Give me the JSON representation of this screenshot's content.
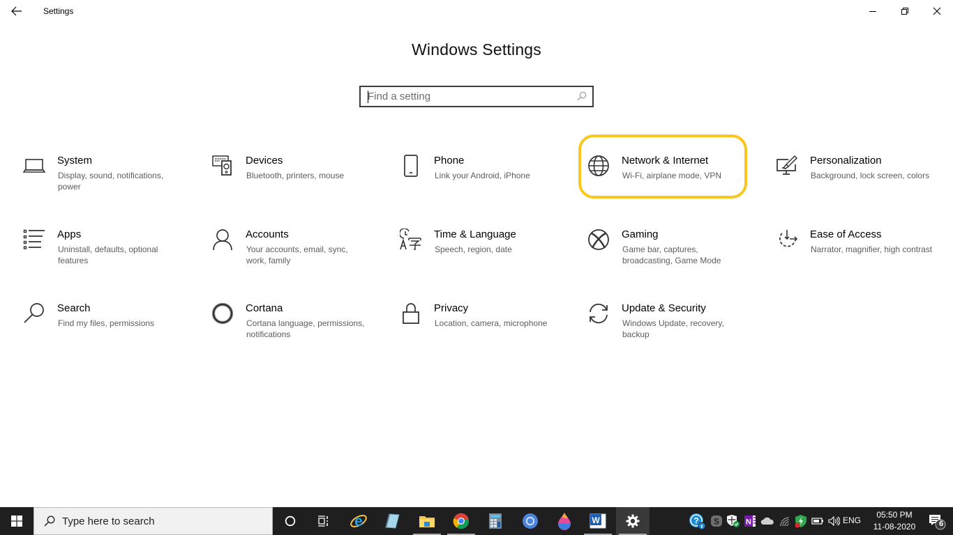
{
  "window": {
    "app_title": "Settings",
    "controls": {
      "minimize": "minimize",
      "restore": "restore",
      "close": "close"
    }
  },
  "main": {
    "title": "Windows Settings",
    "search": {
      "placeholder": "Find a setting",
      "value": ""
    },
    "highlighted_tile": "Network & Internet",
    "highlight_color": "#fac71c",
    "tiles": [
      {
        "name": "System",
        "desc": "Display, sound, notifications, power",
        "icon": "laptop-icon"
      },
      {
        "name": "Devices",
        "desc": "Bluetooth, printers, mouse",
        "icon": "devices-icon"
      },
      {
        "name": "Phone",
        "desc": "Link your Android, iPhone",
        "icon": "phone-icon"
      },
      {
        "name": "Network & Internet",
        "desc": "Wi-Fi, airplane mode, VPN",
        "icon": "globe-icon"
      },
      {
        "name": "Personalization",
        "desc": "Background, lock screen, colors",
        "icon": "paintbrush-monitor-icon"
      },
      {
        "name": "Apps",
        "desc": "Uninstall, defaults, optional features",
        "icon": "apps-list-icon"
      },
      {
        "name": "Accounts",
        "desc": "Your accounts, email, sync, work, family",
        "icon": "person-icon"
      },
      {
        "name": "Time & Language",
        "desc": "Speech, region, date",
        "icon": "time-language-icon"
      },
      {
        "name": "Gaming",
        "desc": "Game bar, captures, broadcasting, Game Mode",
        "icon": "xbox-icon"
      },
      {
        "name": "Ease of Access",
        "desc": "Narrator, magnifier, high contrast",
        "icon": "ease-of-access-icon"
      },
      {
        "name": "Search",
        "desc": "Find my files, permissions",
        "icon": "magnifier-icon"
      },
      {
        "name": "Cortana",
        "desc": "Cortana language, permissions, notifications",
        "icon": "cortana-ring-icon"
      },
      {
        "name": "Privacy",
        "desc": "Location, camera, microphone",
        "icon": "lock-icon"
      },
      {
        "name": "Update & Security",
        "desc": "Windows Update, recovery, backup",
        "icon": "sync-arrows-icon"
      }
    ]
  },
  "taskbar": {
    "search_placeholder": "Type here to search",
    "apps": [
      {
        "name": "Cortana",
        "icon": "cortana-circle-icon",
        "running": false
      },
      {
        "name": "Task View",
        "icon": "task-view-icon",
        "running": false
      },
      {
        "name": "Internet Explorer",
        "icon": "ie-icon",
        "running": false
      },
      {
        "name": "Notepad",
        "icon": "notepad-icon",
        "running": false
      },
      {
        "name": "File Explorer",
        "icon": "folder-icon",
        "running": true
      },
      {
        "name": "Google Chrome",
        "icon": "chrome-icon",
        "running": true
      },
      {
        "name": "Calculator",
        "icon": "calculator-icon",
        "running": false
      },
      {
        "name": "Chromium",
        "icon": "chromium-icon",
        "running": false
      },
      {
        "name": "Paint 3D",
        "icon": "paint3d-icon",
        "running": false
      },
      {
        "name": "Microsoft Word",
        "icon": "word-icon",
        "running": true
      },
      {
        "name": "Settings",
        "icon": "gear-icon",
        "running": true,
        "active": true
      }
    ],
    "tray": {
      "icons": [
        "help-icon",
        "skype-icon",
        "defender-icon",
        "onenote-icon",
        "onedrive-icon",
        "wifi-icon",
        "security-status-icon",
        "battery-icon",
        "volume-icon"
      ],
      "language": "ENG",
      "time": "05:50 PM",
      "date": "11-08-2020",
      "notification_count": "6"
    }
  }
}
